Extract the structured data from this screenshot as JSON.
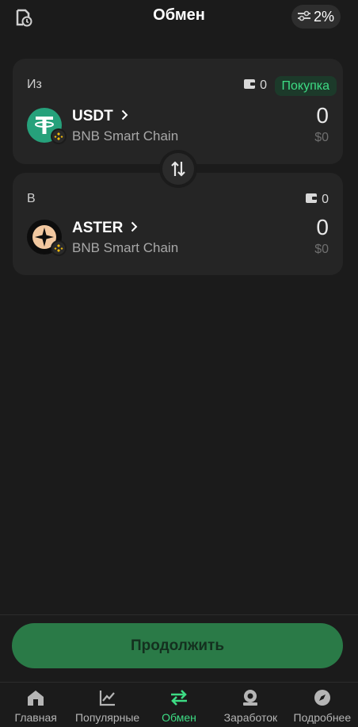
{
  "header": {
    "title": "Обмен",
    "slippage": "2%"
  },
  "from": {
    "label": "Из",
    "balance": "0",
    "buy_label": "Покупка",
    "token": "USDT",
    "chain": "BNB Smart Chain",
    "amount": "0",
    "usd": "$0"
  },
  "to": {
    "label": "В",
    "balance": "0",
    "token": "ASTER",
    "chain": "BNB Smart Chain",
    "amount": "0",
    "usd": "$0"
  },
  "continue_label": "Продолжить",
  "nav": [
    {
      "label": "Главная",
      "icon": "home-icon"
    },
    {
      "label": "Популярные",
      "icon": "chart-icon"
    },
    {
      "label": "Обмен",
      "icon": "swap-icon",
      "active": true
    },
    {
      "label": "Заработок",
      "icon": "earn-icon"
    },
    {
      "label": "Подробнее",
      "icon": "compass-icon"
    }
  ],
  "colors": {
    "accent": "#3ddc84",
    "button": "#2a7a47",
    "usdt": "#26a17b",
    "bnb": "#f0b90b"
  }
}
